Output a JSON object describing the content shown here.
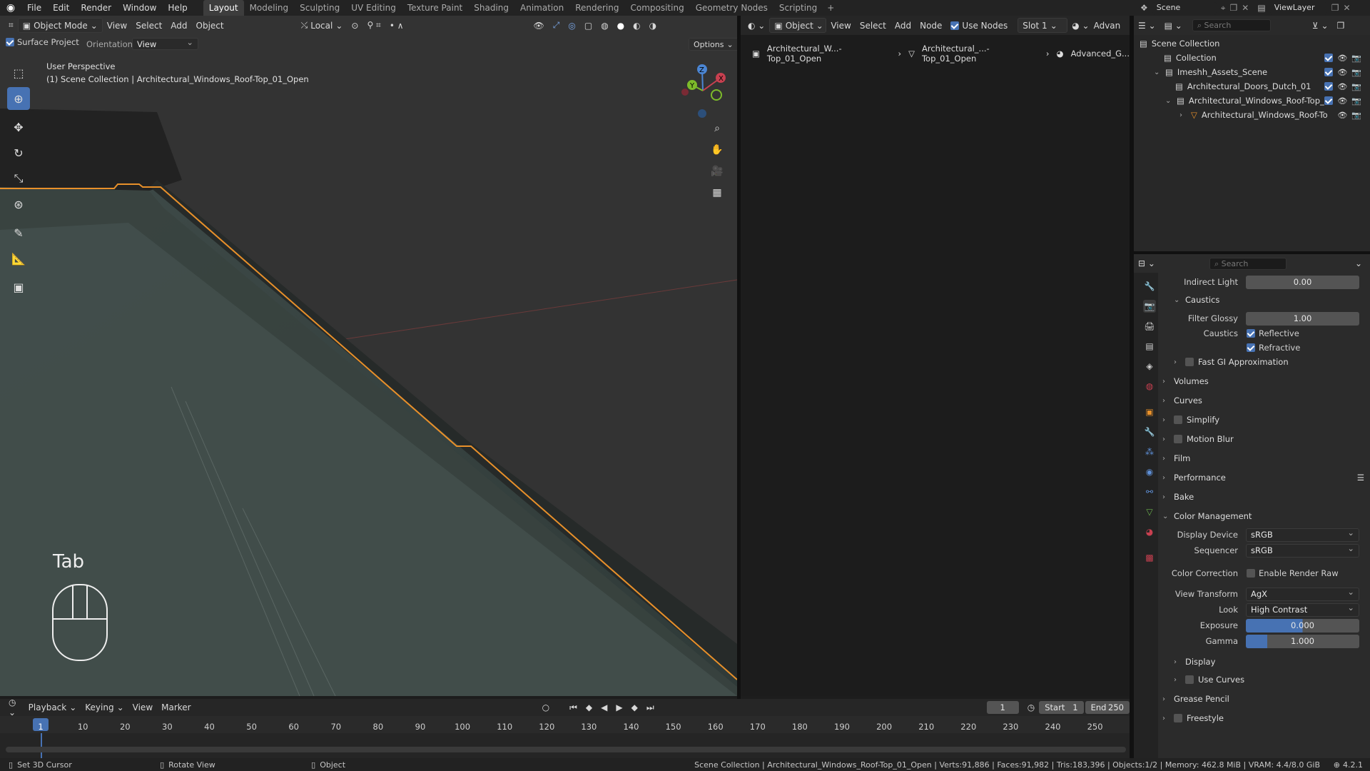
{
  "menu": [
    "File",
    "Edit",
    "Render",
    "Window",
    "Help"
  ],
  "workspaces": [
    "Layout",
    "Modeling",
    "Sculpting",
    "UV Editing",
    "Texture Paint",
    "Shading",
    "Animation",
    "Rendering",
    "Compositing",
    "Geometry Nodes",
    "Scripting"
  ],
  "active_workspace": "Layout",
  "scene": {
    "name": "Scene",
    "view_layer": "ViewLayer"
  },
  "viewport": {
    "mode": "Object Mode",
    "menus": [
      "View",
      "Select",
      "Add",
      "Object"
    ],
    "transform_orientation": "Local",
    "surface_project": "Surface Project",
    "orientation_label": "Orientation:",
    "orientation_value": "View",
    "options": "Options",
    "persp": "User Perspective",
    "collection": "(1) Scene Collection | Architectural_Windows_Roof-Top_01_Open",
    "key_hint": "Tab"
  },
  "node_editor": {
    "type": "Object",
    "menus": [
      "View",
      "Select",
      "Add",
      "Node"
    ],
    "use_nodes": "Use Nodes",
    "slot": "Slot 1",
    "advanced": "Advan",
    "breadcrumb": [
      "Architectural_W...-Top_01_Open",
      "Architectural_...-Top_01_Open",
      "Advanced_G..."
    ]
  },
  "outliner": {
    "search": "Search",
    "rows": [
      {
        "label": "Scene Collection"
      },
      {
        "label": "Collection"
      },
      {
        "label": "Imeshh_Assets_Scene"
      },
      {
        "label": "Architectural_Doors_Dutch_01"
      },
      {
        "label": "Architectural_Windows_Roof-Top_0"
      },
      {
        "label": "Architectural_Windows_Roof-To"
      }
    ]
  },
  "properties": {
    "search": "Search",
    "indirect_light": {
      "label": "Indirect Light",
      "value": "0.00"
    },
    "caustics_panel": "Caustics",
    "filter_glossy": {
      "label": "Filter Glossy",
      "value": "1.00"
    },
    "caustics_label": "Caustics",
    "reflective": "Reflective",
    "refractive": "Refractive",
    "panels": [
      "Fast GI Approximation",
      "Volumes",
      "Curves",
      "Simplify",
      "Motion Blur",
      "Film",
      "Performance",
      "Bake",
      "Color Management"
    ],
    "display_device": {
      "label": "Display Device",
      "value": "sRGB"
    },
    "sequencer": {
      "label": "Sequencer",
      "value": "sRGB"
    },
    "color_correction": {
      "label": "Color Correction",
      "value": "Enable Render Raw"
    },
    "view_transform": {
      "label": "View Transform",
      "value": "AgX"
    },
    "look": {
      "label": "Look",
      "value": "High Contrast"
    },
    "exposure": {
      "label": "Exposure",
      "value": "0.000"
    },
    "gamma": {
      "label": "Gamma",
      "value": "1.000"
    },
    "subpanels": [
      "Display",
      "Use Curves"
    ],
    "bottom_panels": [
      "Grease Pencil",
      "Freestyle"
    ]
  },
  "timeline": {
    "menus": [
      "Playback",
      "Keying",
      "View",
      "Marker"
    ],
    "current_frame": "1",
    "start_label": "Start",
    "start": "1",
    "end_label": "End",
    "end": "250",
    "ticks": [
      "1",
      "10",
      "20",
      "30",
      "40",
      "50",
      "60",
      "70",
      "80",
      "90",
      "100",
      "110",
      "120",
      "130",
      "140",
      "150",
      "160",
      "170",
      "180",
      "190",
      "200",
      "210",
      "220",
      "230",
      "240",
      "250"
    ]
  },
  "status": {
    "left": [
      "Set 3D Cursor",
      "Rotate View",
      "Object"
    ],
    "right": "Scene Collection | Architectural_Windows_Roof-Top_01_Open | Verts:91,886 | Faces:91,982 | Tris:183,396 | Objects:1/2 | Memory: 462.8 MiB | VRAM: 4.4/8.0 GiB",
    "version": "4.2.1"
  }
}
